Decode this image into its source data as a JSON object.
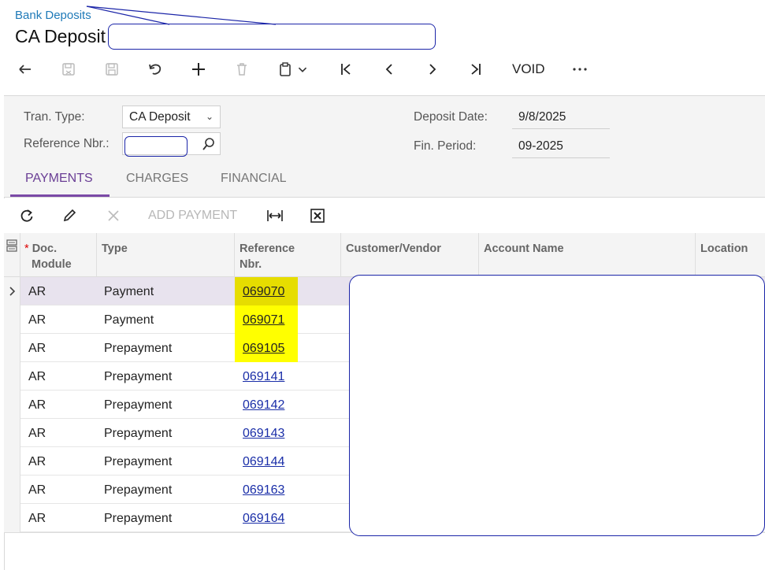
{
  "breadcrumb": "Bank Deposits",
  "page_title": "CA Deposit",
  "toolbar": {
    "void_label": "VOID",
    "icons": [
      "back-icon",
      "save-close-icon",
      "save-icon",
      "undo-icon",
      "add-icon",
      "delete-icon",
      "clipboard-icon",
      "first-icon",
      "previous-icon",
      "next-icon",
      "last-icon",
      "more-icon"
    ]
  },
  "form": {
    "tran_type_label": "Tran. Type:",
    "tran_type_value": "CA Deposit",
    "ref_nbr_label": "Reference Nbr.:",
    "deposit_date_label": "Deposit Date:",
    "deposit_date_value": "9/8/2025",
    "fin_period_label": "Fin. Period:",
    "fin_period_value": "09-2025"
  },
  "tabs": [
    "PAYMENTS",
    "CHARGES",
    "FINANCIAL"
  ],
  "grid_toolbar": {
    "add_payment_label": "ADD PAYMENT",
    "icons": [
      "refresh-icon",
      "edit-icon",
      "delete-row-icon",
      "fit-columns-icon",
      "excel-icon"
    ]
  },
  "grid": {
    "headers": {
      "doc_module_line1": "Doc.",
      "doc_module_line2": "Module",
      "required_mark": "*",
      "type": "Type",
      "ref_line1": "Reference",
      "ref_line2": "Nbr.",
      "customer": "Customer/Vendor",
      "account": "Account Name",
      "location": "Location"
    },
    "rows": [
      {
        "module": "AR",
        "type": "Payment",
        "ref": "069070"
      },
      {
        "module": "AR",
        "type": "Payment",
        "ref": "069071"
      },
      {
        "module": "AR",
        "type": "Prepayment",
        "ref": "069105"
      },
      {
        "module": "AR",
        "type": "Prepayment",
        "ref": "069141"
      },
      {
        "module": "AR",
        "type": "Prepayment",
        "ref": "069142"
      },
      {
        "module": "AR",
        "type": "Prepayment",
        "ref": "069143"
      },
      {
        "module": "AR",
        "type": "Prepayment",
        "ref": "069144"
      },
      {
        "module": "AR",
        "type": "Prepayment",
        "ref": "069163"
      },
      {
        "module": "AR",
        "type": "Prepayment",
        "ref": "069164"
      }
    ]
  },
  "colors": {
    "accent": "#7b4aa6",
    "link": "#1a2ea8",
    "highlight": "#ffff00",
    "annotation": "#1b25a8"
  }
}
